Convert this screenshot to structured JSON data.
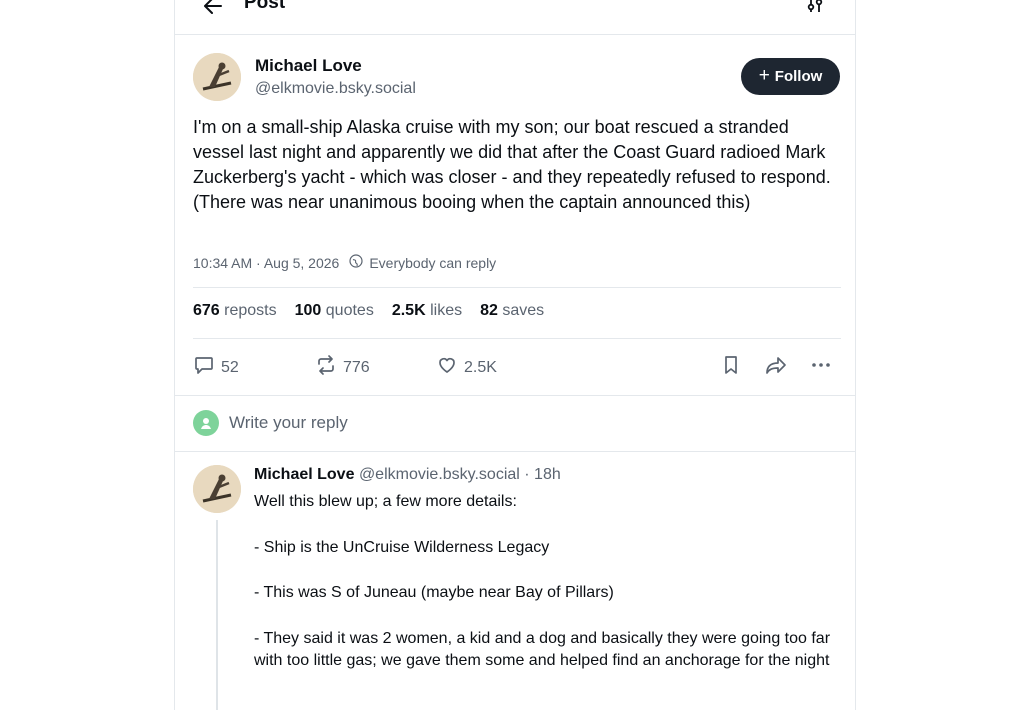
{
  "header": {
    "title": "Post"
  },
  "post": {
    "author_name": "Michael Love",
    "author_handle": "@elkmovie.bsky.social",
    "follow_label": "Follow",
    "text": "I'm on a small-ship Alaska cruise with my son; our boat rescued a stranded vessel last night and apparently we did that after the Coast Guard radioed Mark Zuckerberg's yacht - which was closer - and they repeatedly refused to respond. (There was near unanimous booing when the captain announced this)",
    "timestamp": "10:34 AM · Aug 5, 2026",
    "reply_setting": "Everybody can reply",
    "stats": {
      "reposts_count": "676",
      "reposts_label": "reposts",
      "quotes_count": "100",
      "quotes_label": "quotes",
      "likes_count": "2.5K",
      "likes_label": "likes",
      "saves_count": "82",
      "saves_label": "saves"
    },
    "actions": {
      "replies": "52",
      "reposts": "776",
      "likes": "2.5K"
    }
  },
  "reply_composer": {
    "placeholder": "Write your reply"
  },
  "reply": {
    "author_name": "Michael Love",
    "author_handle": "@elkmovie.bsky.social",
    "age": "· 18h",
    "paragraphs": [
      "Well this blew up; a few more details:",
      "- Ship is the UnCruise Wilderness Legacy",
      "- This was S of Juneau (maybe near Bay of Pillars)",
      "- They said it was 2 women, a kid and a dog and basically they were going too far with too little gas; we gave them some and helped find an anchorage for the night"
    ]
  },
  "icons": {
    "back": "arrow-left-icon",
    "settings": "tune-icon",
    "reply": "comment-icon",
    "repost": "repost-icon",
    "like": "heart-icon",
    "bookmark": "bookmark-icon",
    "share": "share-icon",
    "more": "more-icon",
    "globe": "globe-icon"
  },
  "colors": {
    "follow_bg": "#1e2631",
    "muted": "#5b6470",
    "divider": "#e4e8ec",
    "reply_avatar": "#7ed39a"
  }
}
